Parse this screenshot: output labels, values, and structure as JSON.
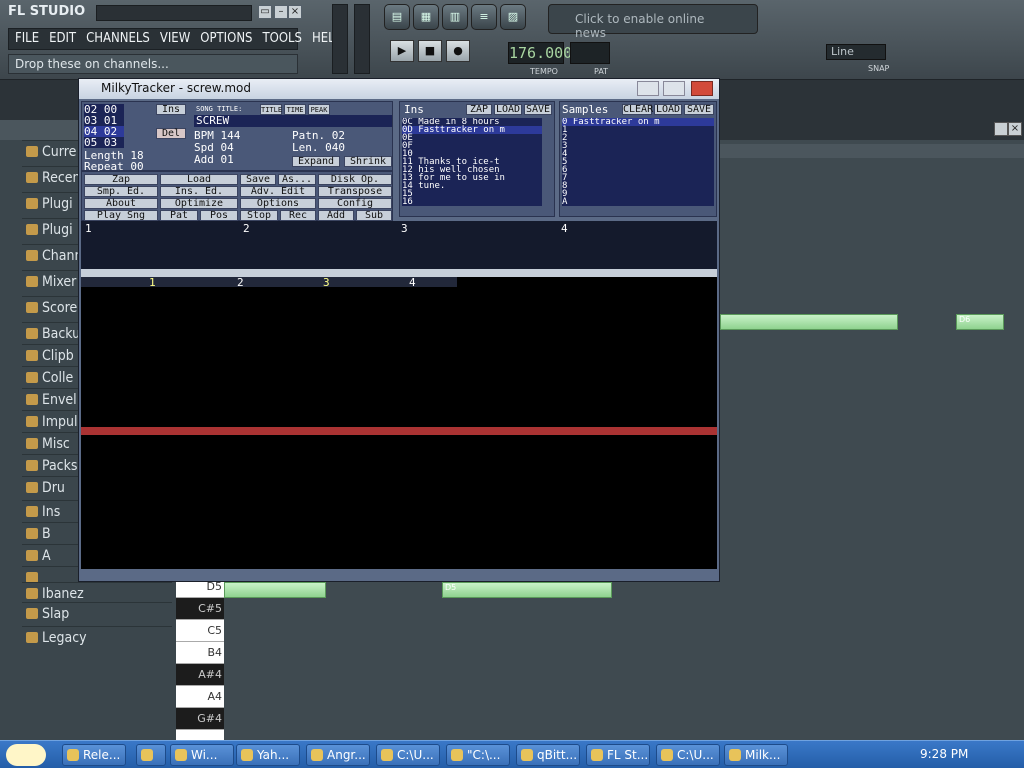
{
  "fl": {
    "title": "FL STUDIO",
    "menu": [
      "FILE",
      "EDIT",
      "CHANNELS",
      "VIEW",
      "OPTIONS",
      "TOOLS",
      "HELP"
    ],
    "hint": "Drop these on channels...",
    "news": "Click to enable online news",
    "tempo": "176.000",
    "tempo_label": "TEMPO",
    "pat_label": "PAT",
    "snap": "Line",
    "snap_label": "SNAP"
  },
  "browser": {
    "items": [
      "Curre",
      "Recen",
      "Plugi",
      "Plugi",
      "Chann",
      "Mixer",
      "Score",
      "Backu",
      "Clipb",
      "Colle",
      "Envel",
      "Impul",
      "Misc",
      "Packs",
      "Dru",
      "Ins",
      "B",
      "A",
      "",
      "Ibanez",
      "Slap",
      "Legacy"
    ]
  },
  "piano": {
    "keys": [
      {
        "label": "D5",
        "black": false
      },
      {
        "label": "C#5",
        "black": true
      },
      {
        "label": "C5",
        "black": false
      },
      {
        "label": "B4",
        "black": false
      },
      {
        "label": "A#4",
        "black": true
      },
      {
        "label": "A4",
        "black": false
      },
      {
        "label": "G#4",
        "black": true
      }
    ],
    "note_labels": [
      "D6",
      "D5"
    ]
  },
  "tracker": {
    "title": "MilkyTracker - screw.mod",
    "song_title_label": "SONG TITLE:",
    "title_tabs": [
      "TITLE",
      "TIME",
      "PEAK"
    ],
    "song_title": "SCREW",
    "order_list": [
      "02 00",
      "03 01",
      "04 02",
      "05 03"
    ],
    "length": "Length 18",
    "repeat": "Repeat 00",
    "bpm": "BPM 144",
    "spd": "Spd  04",
    "add": "Add  01",
    "patn": "Patn.  02",
    "len": "Len.  040",
    "expand": "Expand",
    "shrink": "Shrink",
    "buttons": [
      [
        "Zap",
        "Load",
        "Save",
        "As...",
        "Disk Op."
      ],
      [
        "Smp. Ed.",
        "Ins. Ed.",
        "Adv. Edit",
        "Transpose"
      ],
      [
        "About",
        "Optimize",
        "Options",
        "Config"
      ],
      [
        "Play Sng",
        "Pat",
        "Pos",
        "Stop",
        "Rec",
        "Add",
        "Sub"
      ]
    ],
    "ins_label": "Ins",
    "ins_buttons": [
      "ZAP",
      "LOAD",
      "SAVE"
    ],
    "instruments": [
      "0C Made in 8 hours",
      "0D Fasttracker on m",
      "0E",
      "0F",
      "10",
      "11 Thanks to ice-t",
      "12 his well chosen",
      "13 for me to use in",
      "14 tune.",
      "15",
      "16"
    ],
    "samples_label": "Samples",
    "sample_buttons": [
      "CLEAR",
      "LOAD",
      "SAVE"
    ],
    "samples": [
      "0 Fasttracker on m",
      "1",
      "2",
      "3",
      "4",
      "5",
      "6",
      "7",
      "8",
      "9",
      "A"
    ],
    "scopes": [
      "1",
      "2",
      "3",
      "4"
    ],
    "channels": [
      "1",
      "2",
      "3",
      "4"
    ]
  },
  "taskbar": {
    "tasks": [
      "Rele...",
      "",
      "Wi...",
      "Yah...",
      "Angr...",
      "C:\\U...",
      "\"C:\\...",
      "qBitt...",
      "FL St...",
      "C:\\U...",
      "Milk..."
    ],
    "clock": "9:28 PM"
  },
  "colors": {
    "accent": "#3a78c8",
    "note": "#8fd28f",
    "tracker_bg": "#5b6a86"
  }
}
